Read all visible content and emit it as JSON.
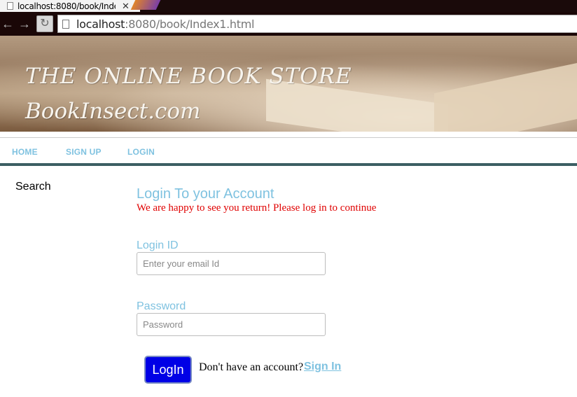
{
  "browser": {
    "tab_title": "localhost:8080/book/Inde",
    "tab_close": "✕",
    "back": "←",
    "forward": "→",
    "reload": "↻",
    "url_host": "localhost",
    "url_rest": ":8080/book/Index1.html"
  },
  "banner": {
    "title": "THE ONLINE BOOK STORE",
    "subtitle": "BookInsect.com"
  },
  "nav": {
    "items": [
      {
        "label": "HOME"
      },
      {
        "label": "SIGN UP"
      },
      {
        "label": "LOGIN"
      }
    ]
  },
  "sidebar": {
    "search_label": "Search"
  },
  "login_form": {
    "title": "Login To your Account",
    "subtitle": "We are happy to see you return! Please log in to continue",
    "login_id_label": "Login ID",
    "login_id_placeholder": "Enter your email Id",
    "password_label": "Password",
    "password_placeholder": "Password",
    "login_button": "LogIn",
    "no_account_text": "Don't have an account?",
    "sign_in_link": "Sign In"
  }
}
